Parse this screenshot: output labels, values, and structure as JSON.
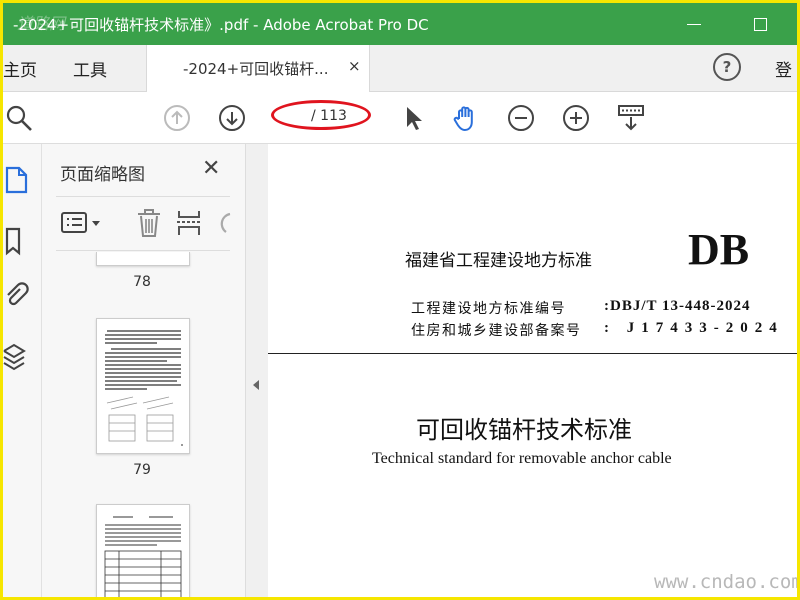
{
  "window": {
    "title": "-2024+可回收锚杆技术标准》.pdf - Adobe Acrobat Pro DC",
    "corner_watermark": "道路网"
  },
  "tabs": {
    "home": "主页",
    "tools": "工具",
    "document": "-2024+可回收锚杆...",
    "close": "×",
    "help": "?",
    "signin": "登"
  },
  "toolbar": {
    "page_count": "/ 113",
    "icons": [
      "search-icon",
      "prev-page-icon",
      "next-page-icon",
      "select-arrow-icon",
      "hand-tool-icon",
      "zoom-out-icon",
      "zoom-in-icon",
      "scroll-mode-icon"
    ]
  },
  "thumbnails": {
    "title": "页面缩略图",
    "close": "✕",
    "pages": [
      "78",
      "79"
    ]
  },
  "document": {
    "standard_type": "福建省工程建设地方标准",
    "db": "DB",
    "number_label": "工程建设地方标准编号",
    "number_value": ":DBJ/T 13-448-2024",
    "filing_label": "住房和城乡建设部备案号",
    "filing_value": ":  J17433-2024",
    "title_zh": "可回收锚杆技术标准",
    "title_en": "Technical standard for removable anchor cable"
  },
  "watermark": "www.cndao.com",
  "colors": {
    "titlebar": "#3aa14a",
    "frame": "#f6e600",
    "highlight": "#e0141e",
    "icon_blue": "#2a6fdb"
  }
}
